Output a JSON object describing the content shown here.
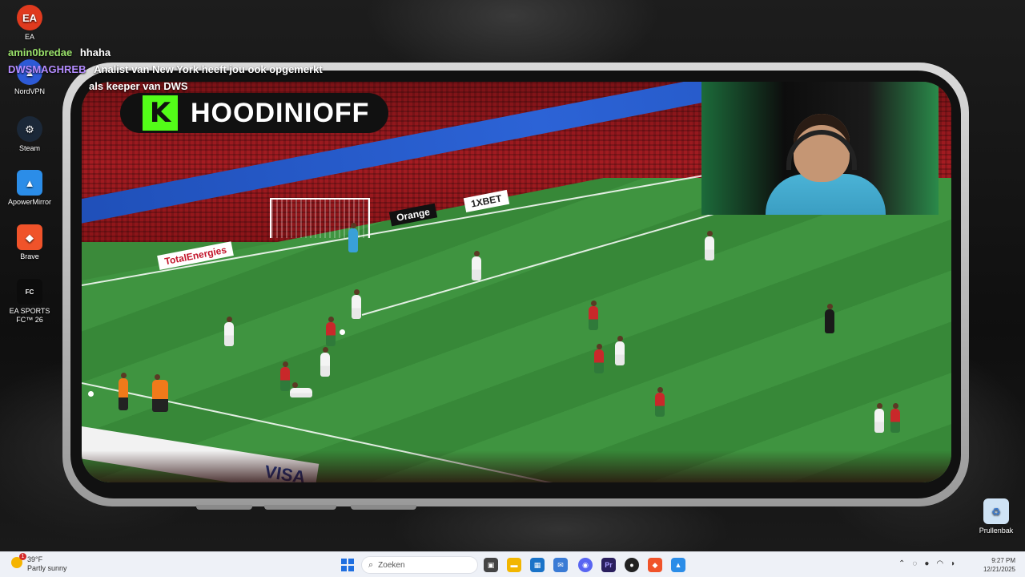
{
  "desktop": {
    "icons": [
      {
        "label": "EA",
        "icon": "ea-icon"
      },
      {
        "label": "NordVPN",
        "icon": "nordvpn-icon"
      },
      {
        "label": "Steam",
        "icon": "steam-icon"
      },
      {
        "label": "ApowerMirror",
        "icon": "apowermirror-icon"
      },
      {
        "label": "Brave",
        "icon": "brave-icon"
      },
      {
        "label": "EA SPORTS FC™ 26",
        "icon": "ea-sports-fc-icon"
      }
    ],
    "recycle_bin": {
      "label": "Prullenbak",
      "icon": "recycle-bin-icon"
    }
  },
  "chat": {
    "messages": [
      {
        "user": "amin0bredae",
        "text": "hhaha"
      },
      {
        "user": "DWSMAGHREB",
        "text": "Analist van New York heeft jou ook opgemerkt"
      },
      {
        "user": "",
        "text": "als keeper van DWS"
      }
    ]
  },
  "stream": {
    "channel_name": "HOODINIOFF",
    "platform_logo": "K",
    "ads": [
      "TotalEnergies",
      "Orange",
      "1XBET",
      "VISA"
    ]
  },
  "taskbar": {
    "weather_temp": "39°F",
    "weather_desc": "Partly sunny",
    "search_placeholder": "Zoeken",
    "time": "9:27 PM",
    "date": "12/21/2025"
  },
  "colors": {
    "kick_green": "#53fc18",
    "chat_user1": "#9be36b",
    "chat_user2": "#b48cff",
    "taskbar_bg": "#eef1f7"
  }
}
